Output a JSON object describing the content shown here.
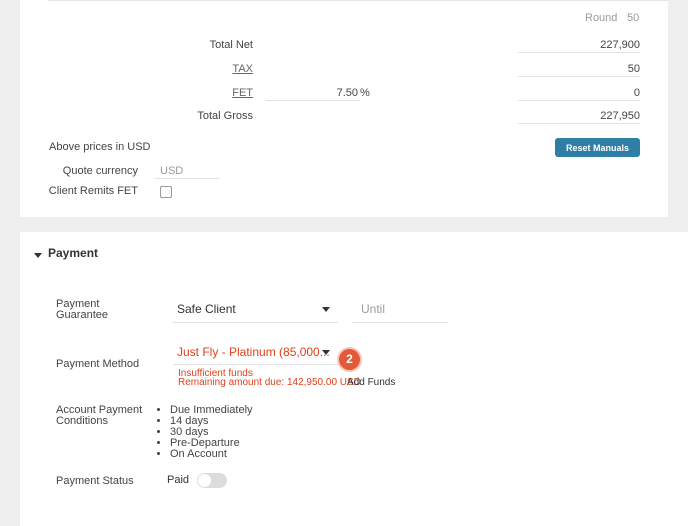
{
  "totals": {
    "round_label": "Round",
    "round_value": "50",
    "total_net_label": "Total Net",
    "total_net_value": "227,900",
    "tax_label": "TAX",
    "tax_value": "50",
    "fet_label": "FET",
    "fet_percent": "7.50",
    "percent_sign": "%",
    "fet_value": "0",
    "total_gross_label": "Total Gross",
    "total_gross_value": "227,950",
    "above_prices": "Above prices in USD",
    "reset_button": "Reset Manuals",
    "quote_currency_label": "Quote currency",
    "quote_currency_value": "USD",
    "client_remits_label": "Client Remits FET"
  },
  "payment": {
    "title": "Payment",
    "guarantee_label_1": "Payment",
    "guarantee_label_2": "Guarantee",
    "guarantee_value": "Safe Client",
    "until_placeholder": "Until",
    "method_label": "Payment Method",
    "method_value": "Just Fly - Platinum (85,000...",
    "badge": "2",
    "insufficient": "Insufficient funds",
    "remaining": "Remaining amount due: 142,950.00 USD",
    "add_funds": "Add Funds",
    "conditions_label_1": "Account Payment",
    "conditions_label_2": "Conditions",
    "conditions": [
      "Due Immediately",
      "14 days",
      "30 days",
      "Pre-Departure",
      "On Account"
    ],
    "status_label": "Payment Status",
    "status_value": "Paid"
  },
  "colors": {
    "accent": "#2e7ea6",
    "error": "#e0411b"
  }
}
